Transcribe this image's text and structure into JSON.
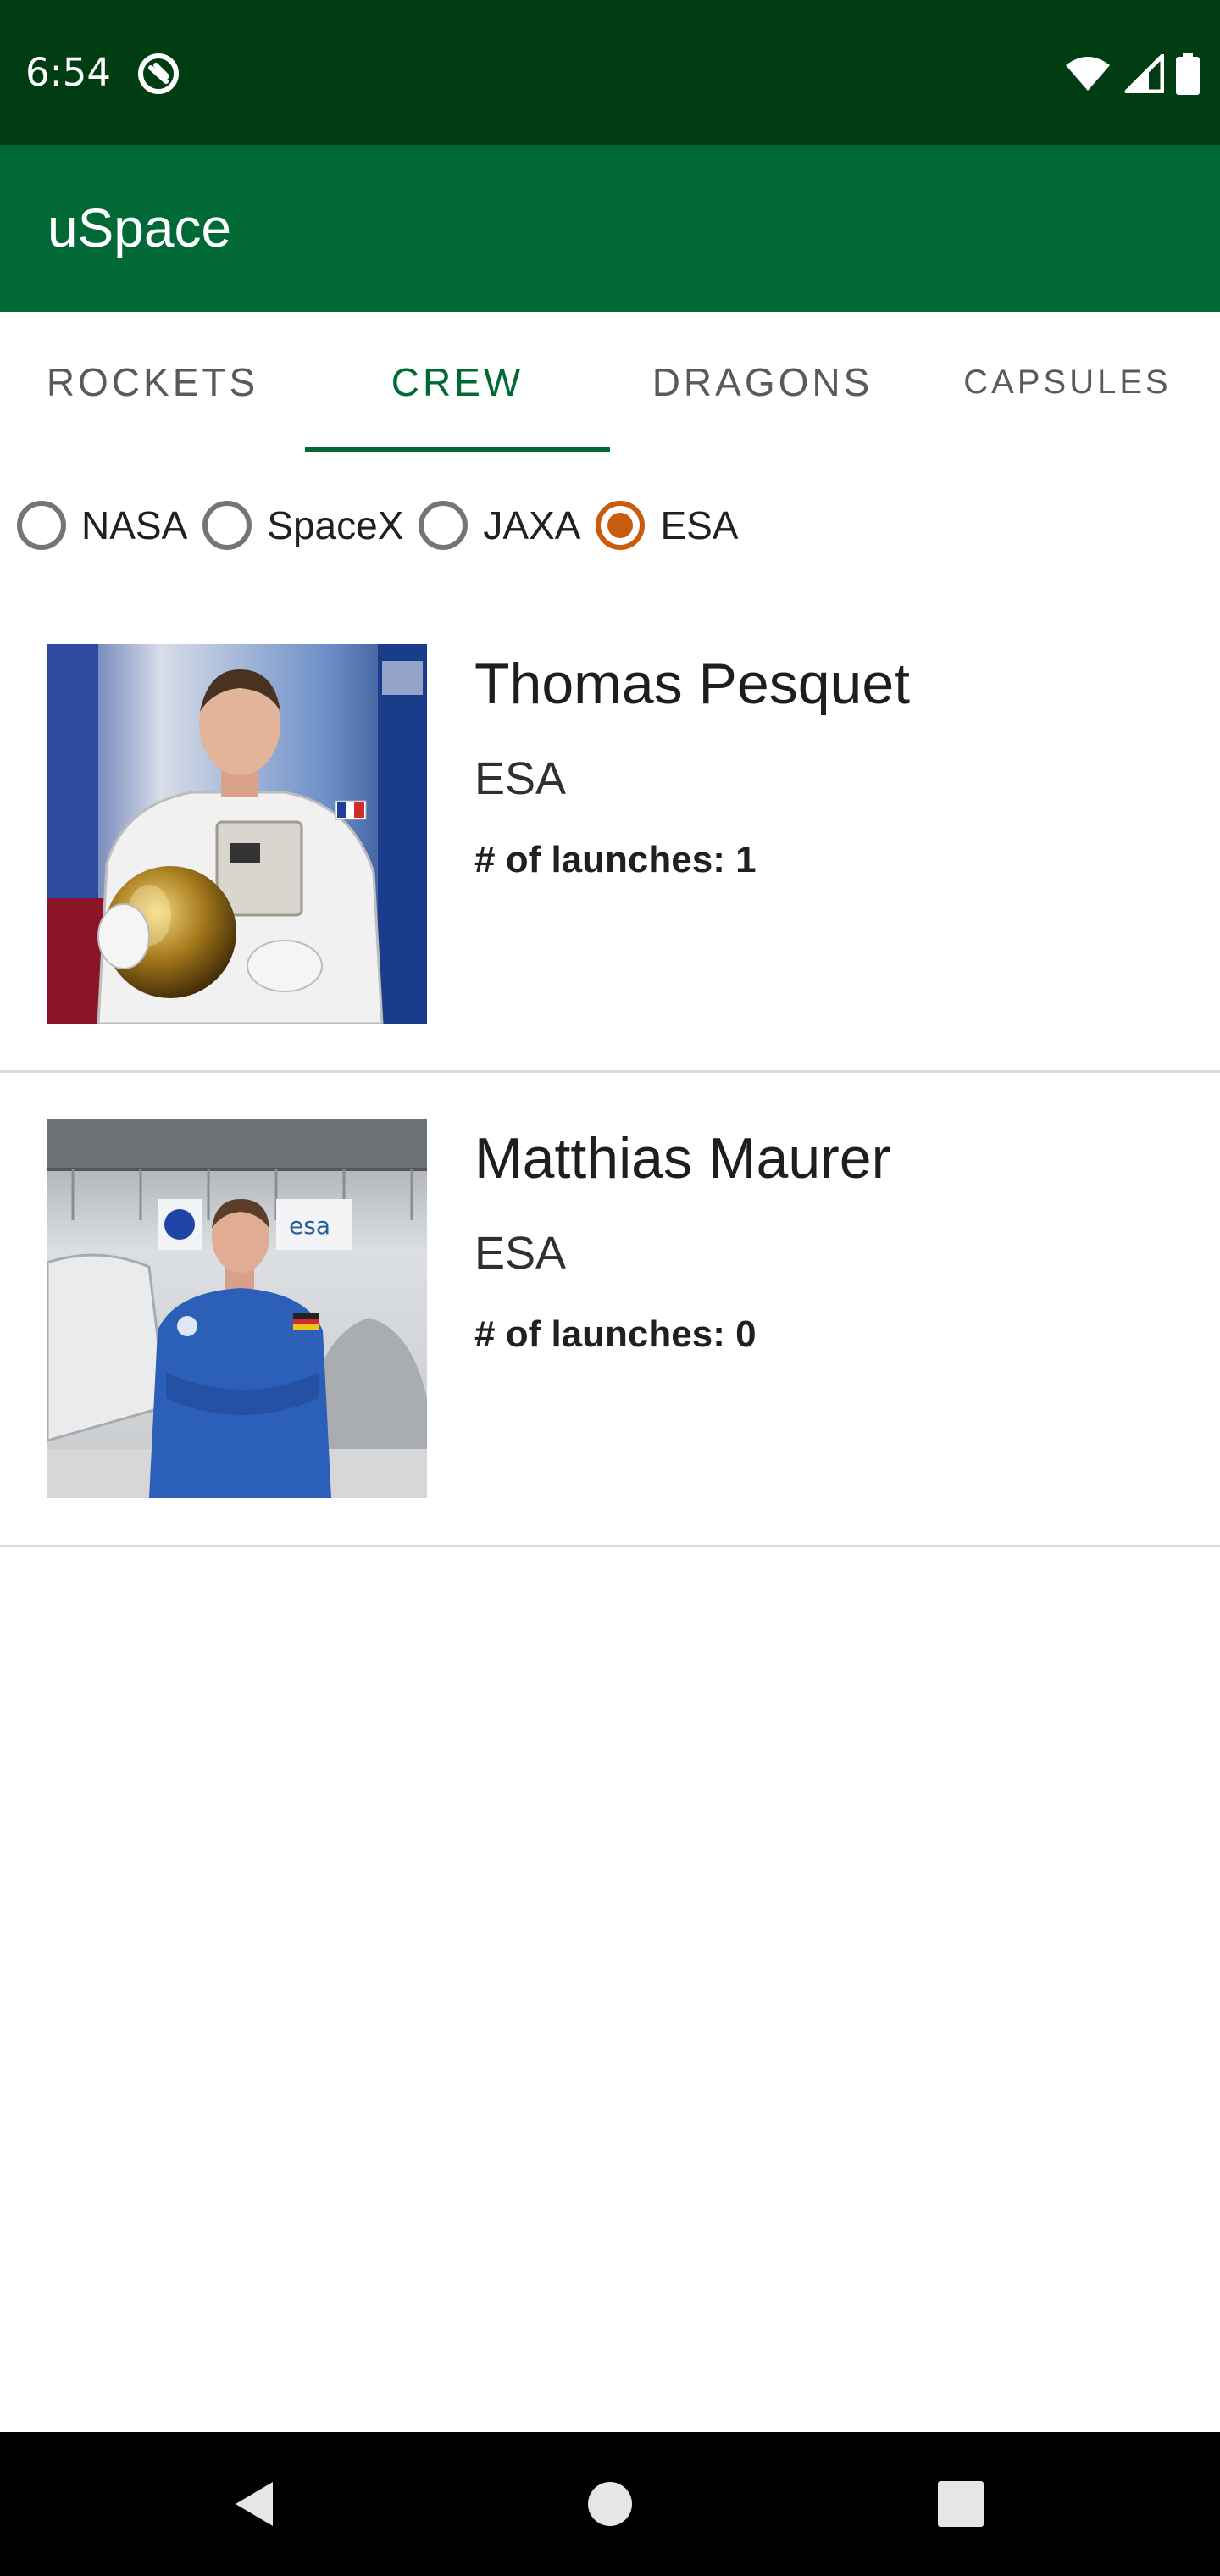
{
  "status_bar": {
    "time": "6:54"
  },
  "app_bar": {
    "title": "uSpace"
  },
  "tabs": [
    {
      "label": "ROCKETS",
      "active": false
    },
    {
      "label": "CREW",
      "active": true
    },
    {
      "label": "DRAGONS",
      "active": false
    },
    {
      "label": "CAPSULES",
      "active": false
    }
  ],
  "agency_filter": {
    "options": [
      "NASA",
      "SpaceX",
      "JAXA",
      "ESA"
    ],
    "selected": "ESA"
  },
  "crew": [
    {
      "name": "Thomas Pesquet",
      "agency": "ESA",
      "launches_label": "# of launches: 1",
      "photo_icon": "astronaut-spacesuit-photo"
    },
    {
      "name": "Matthias Maurer",
      "agency": "ESA",
      "launches_label": "# of launches: 0",
      "photo_icon": "astronaut-flight-suit-photo"
    }
  ],
  "colors": {
    "status_bar": "#003d12",
    "app_bar": "#016935",
    "accent": "#016935",
    "radio_checked": "#c85b0c"
  },
  "icons": {
    "status_left": "app-notification-icon",
    "status_right": [
      "wifi-icon",
      "cell-signal-icon",
      "battery-icon"
    ],
    "nav": [
      "back-icon",
      "home-icon",
      "recents-icon"
    ]
  }
}
